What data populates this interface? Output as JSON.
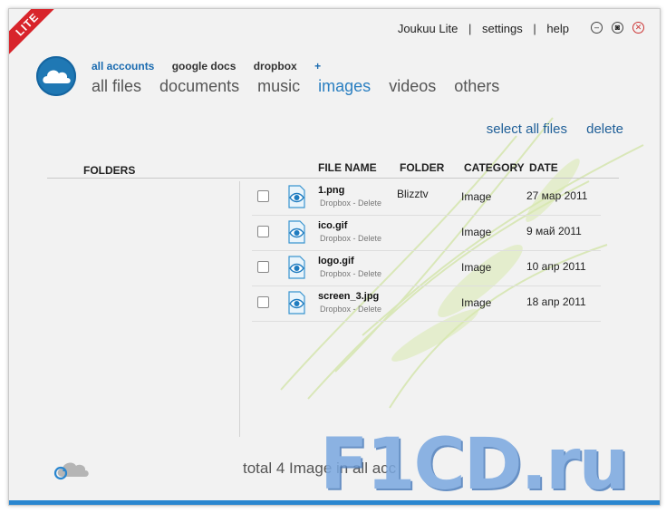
{
  "app": {
    "title": "Joukuu Lite",
    "badge": "LITE"
  },
  "topbar": {
    "settings": "settings",
    "help": "help",
    "sep": "|"
  },
  "window_controls": {
    "minimize": "–",
    "maximize": "◙",
    "close": "✕"
  },
  "accounts": [
    {
      "label": "all accounts",
      "active": true
    },
    {
      "label": "google docs",
      "active": false
    },
    {
      "label": "dropbox",
      "active": false
    },
    {
      "label": "+",
      "active": false
    }
  ],
  "tabs": [
    {
      "label": "all files",
      "active": false
    },
    {
      "label": "documents",
      "active": false
    },
    {
      "label": "music",
      "active": false
    },
    {
      "label": "images",
      "active": true
    },
    {
      "label": "videos",
      "active": false
    },
    {
      "label": "others",
      "active": false
    }
  ],
  "actions": {
    "select_all": "select all files",
    "delete": "delete"
  },
  "folders": {
    "title": "FOLDERS"
  },
  "columns": {
    "file_name": "FILE NAME",
    "folder": "FOLDER",
    "category": "CATEGORY",
    "date": "DATE"
  },
  "files": [
    {
      "name": "1.png",
      "sub": "Dropbox - Delete",
      "folder": "Blizztv",
      "category": "Image",
      "date": "27 мар 2011"
    },
    {
      "name": "ico.gif",
      "sub": "Dropbox - Delete",
      "folder": "",
      "category": "Image",
      "date": "9 май 2011"
    },
    {
      "name": "logo.gif",
      "sub": "Dropbox - Delete",
      "folder": "",
      "category": "Image",
      "date": "10 апр 2011"
    },
    {
      "name": "screen_3.jpg",
      "sub": "Dropbox - Delete",
      "folder": "",
      "category": "Image",
      "date": "18 апр 2011"
    }
  ],
  "footer": {
    "total": "total 4 Image in all accounts"
  },
  "watermark": "F1CD.ru",
  "colors": {
    "accent": "#2a7fc1",
    "link": "#1f5f98",
    "badge": "#d8242b",
    "bottom_bar": "#2a86cf"
  }
}
